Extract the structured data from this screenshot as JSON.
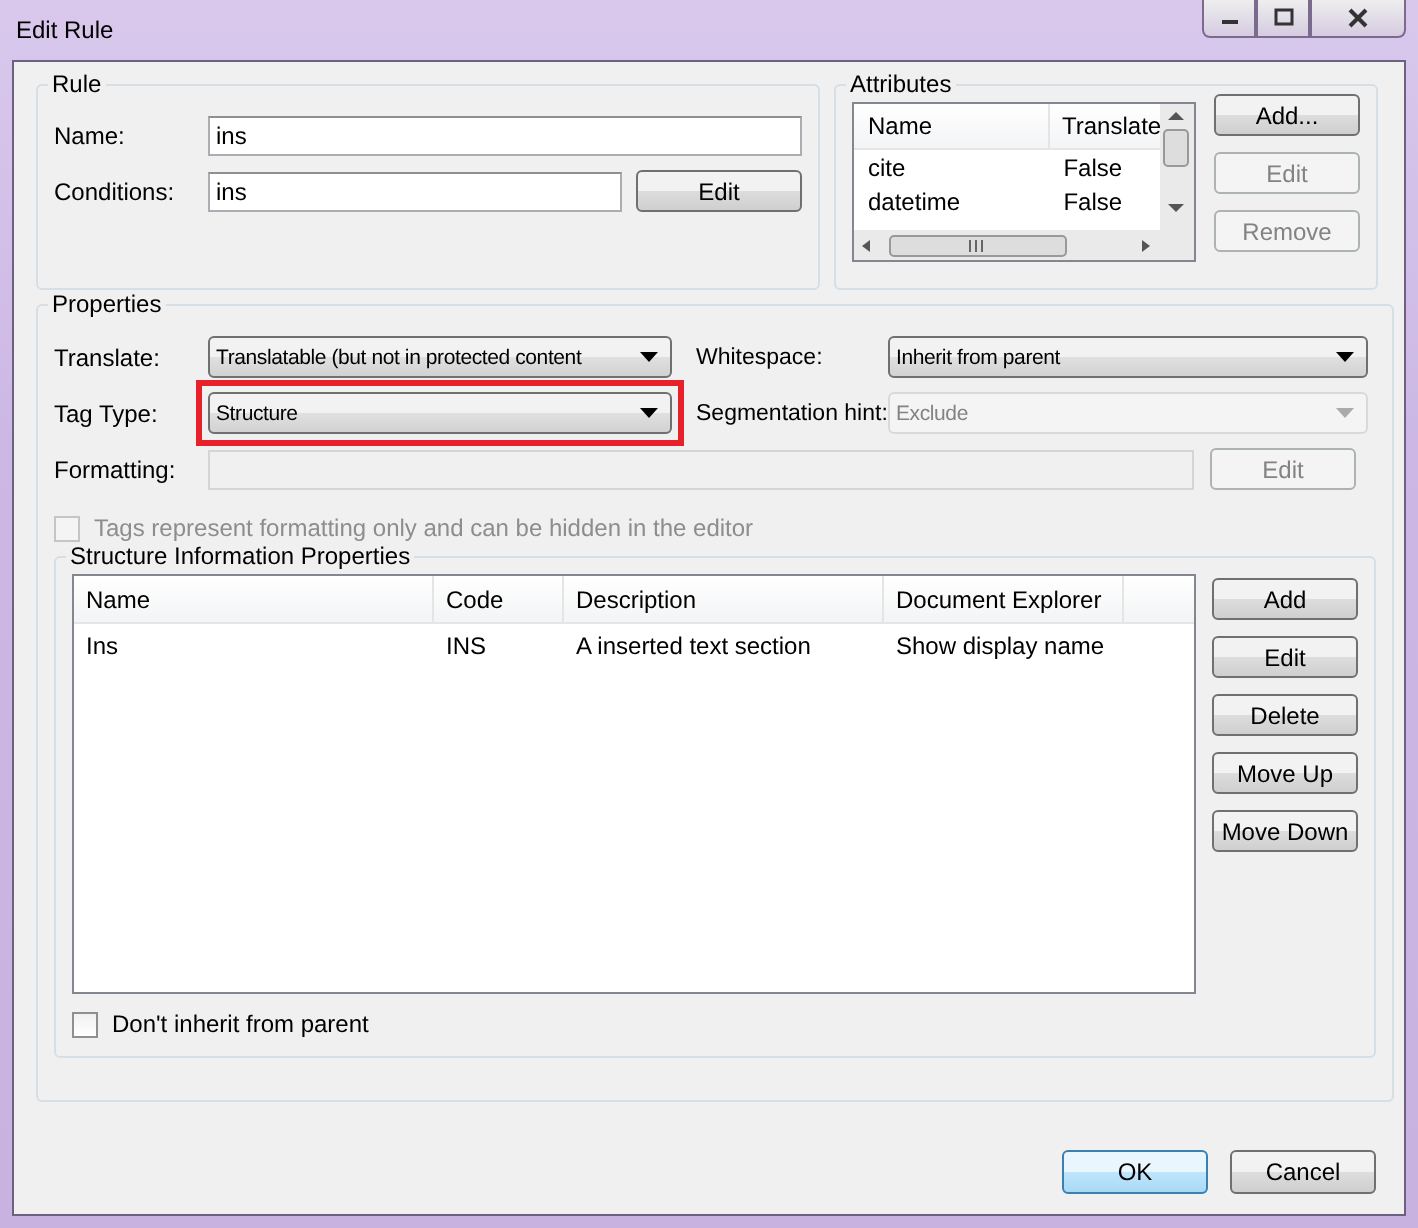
{
  "window": {
    "title": "Edit Rule"
  },
  "rule": {
    "title": "Rule",
    "name_label": "Name:",
    "name_value": "ins",
    "conditions_label": "Conditions:",
    "conditions_value": "ins",
    "edit_button": "Edit"
  },
  "attributes": {
    "title": "Attributes",
    "columns": [
      "Name",
      "Translate"
    ],
    "rows": [
      [
        "cite",
        "False"
      ],
      [
        "datetime",
        "False"
      ]
    ],
    "buttons": [
      {
        "label": "Add...",
        "disabled": false
      },
      {
        "label": "Edit",
        "disabled": true
      },
      {
        "label": "Remove",
        "disabled": true
      }
    ]
  },
  "properties": {
    "title": "Properties",
    "translate": {
      "label": "Translate:",
      "value": "Translatable (but not in protected content",
      "disabled": false,
      "highlighted": false
    },
    "whitespace": {
      "label": "Whitespace:",
      "value": "Inherit from parent",
      "disabled": false,
      "highlighted": false
    },
    "tag_type": {
      "label": "Tag Type:",
      "value": "Structure",
      "disabled": false,
      "highlighted": true
    },
    "segmentation": {
      "label": "Segmentation hint:",
      "value": "Exclude",
      "disabled": true,
      "highlighted": false
    },
    "formatting": {
      "label": "Formatting:",
      "disabled": true,
      "button": "Edit",
      "button_disabled": true
    },
    "hide_tags": {
      "label": "Tags represent formatting only and can be hidden in the editor",
      "checked": false,
      "disabled": true
    }
  },
  "structure": {
    "title": "Structure Information Properties",
    "columns": [
      "Name",
      "Code",
      "Description",
      "Document Explorer"
    ],
    "rows": [
      [
        "Ins",
        "INS",
        "A inserted text section",
        "Show display name"
      ]
    ],
    "buttons": [
      "Add",
      "Edit",
      "Delete",
      "Move Up",
      "Move Down"
    ],
    "dont_inherit": {
      "label": "Don't inherit from parent",
      "checked": false,
      "disabled": false
    }
  },
  "footer": [
    {
      "label": "OK",
      "default": true
    },
    {
      "label": "Cancel",
      "default": false
    }
  ]
}
